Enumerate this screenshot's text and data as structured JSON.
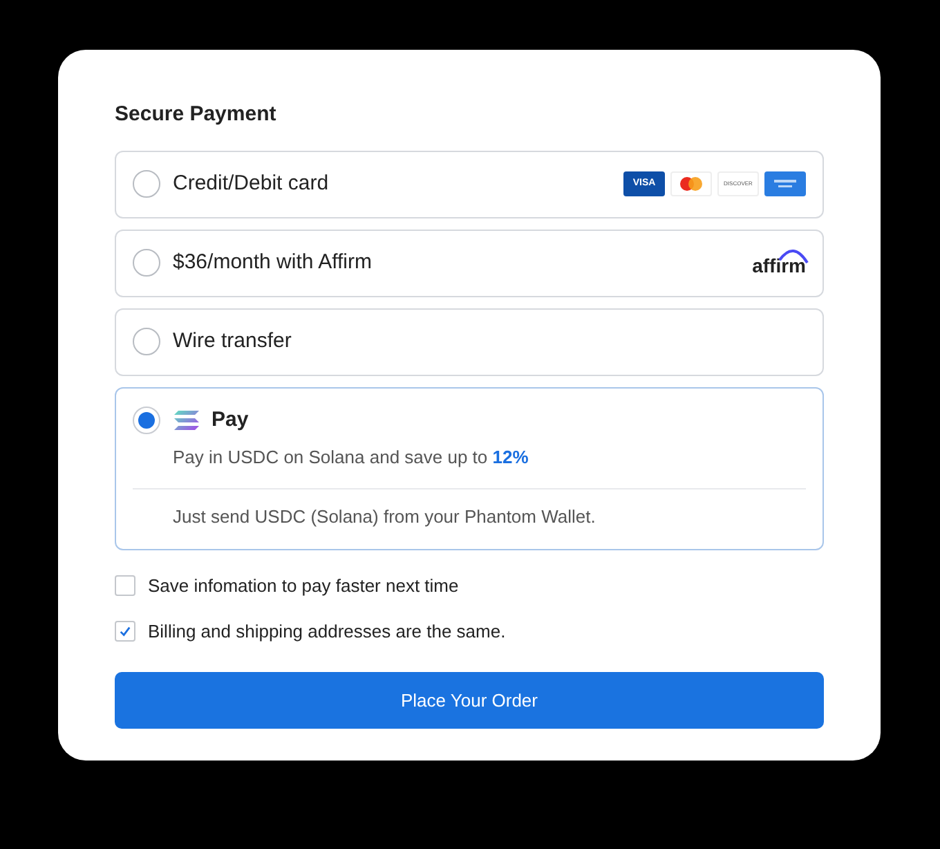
{
  "title": "Secure Payment",
  "options": [
    {
      "kind": "cards",
      "label": "Credit/Debit card",
      "selected": false,
      "brands": [
        {
          "kind": "visa",
          "text": "VISA"
        },
        {
          "kind": "mastercard"
        },
        {
          "kind": "discover",
          "text": "DISCOVER"
        },
        {
          "kind": "amex"
        }
      ]
    },
    {
      "kind": "affirm",
      "label": "$36/month with Affirm",
      "selected": false,
      "logo_text": "affirm"
    },
    {
      "kind": "plain",
      "label": "Wire transfer",
      "selected": false
    },
    {
      "kind": "solana",
      "label": "Pay",
      "selected": true,
      "description": "Pay in USDC on Solana and save up to",
      "highlight": "12%",
      "note": "Just send USDC (Solana) from your Phantom Wallet."
    }
  ],
  "checkboxes": [
    {
      "label": "Save infomation to pay faster next time",
      "checked": false
    },
    {
      "label": "Billing and shipping addresses are the same.",
      "checked": true
    }
  ],
  "submit": "Place Your Order"
}
